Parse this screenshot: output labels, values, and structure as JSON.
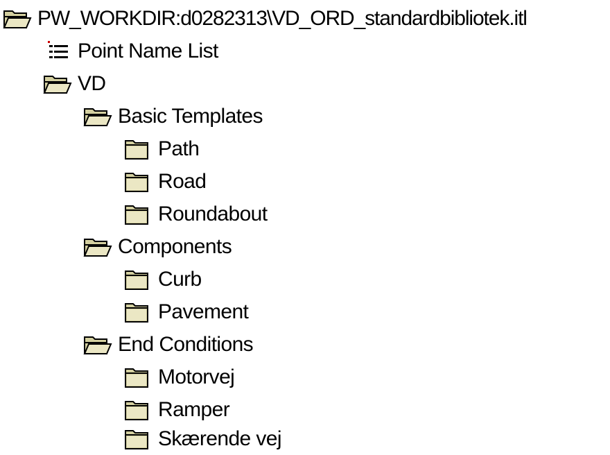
{
  "colors": {
    "folder_fill": "#d4d0a0",
    "folder_front": "#ebe7c4",
    "folder_outline": "#000000",
    "list_marker": "#cc0000",
    "text": "#000000",
    "background": "#ffffff"
  },
  "tree": {
    "root": {
      "label": "PW_WORKDIR:d0282313\\VD_ORD_standardbibliotek.itl",
      "icon": "open-folder-icon"
    },
    "point_name_list": {
      "label": "Point Name List",
      "icon": "list-icon"
    },
    "vd": {
      "label": "VD",
      "icon": "open-folder-icon"
    },
    "basic_templates": {
      "label": "Basic Templates",
      "icon": "open-folder-icon",
      "children": [
        {
          "label": "Path",
          "icon": "folder-icon"
        },
        {
          "label": "Road",
          "icon": "folder-icon"
        },
        {
          "label": "Roundabout",
          "icon": "folder-icon"
        }
      ]
    },
    "components": {
      "label": "Components",
      "icon": "open-folder-icon",
      "children": [
        {
          "label": "Curb",
          "icon": "folder-icon"
        },
        {
          "label": "Pavement",
          "icon": "folder-icon"
        }
      ]
    },
    "end_conditions": {
      "label": "End Conditions",
      "icon": "open-folder-icon",
      "children": [
        {
          "label": "Motorvej",
          "icon": "folder-icon"
        },
        {
          "label": "Ramper",
          "icon": "folder-icon"
        },
        {
          "label": "Skærende vej",
          "icon": "folder-icon"
        }
      ]
    }
  }
}
